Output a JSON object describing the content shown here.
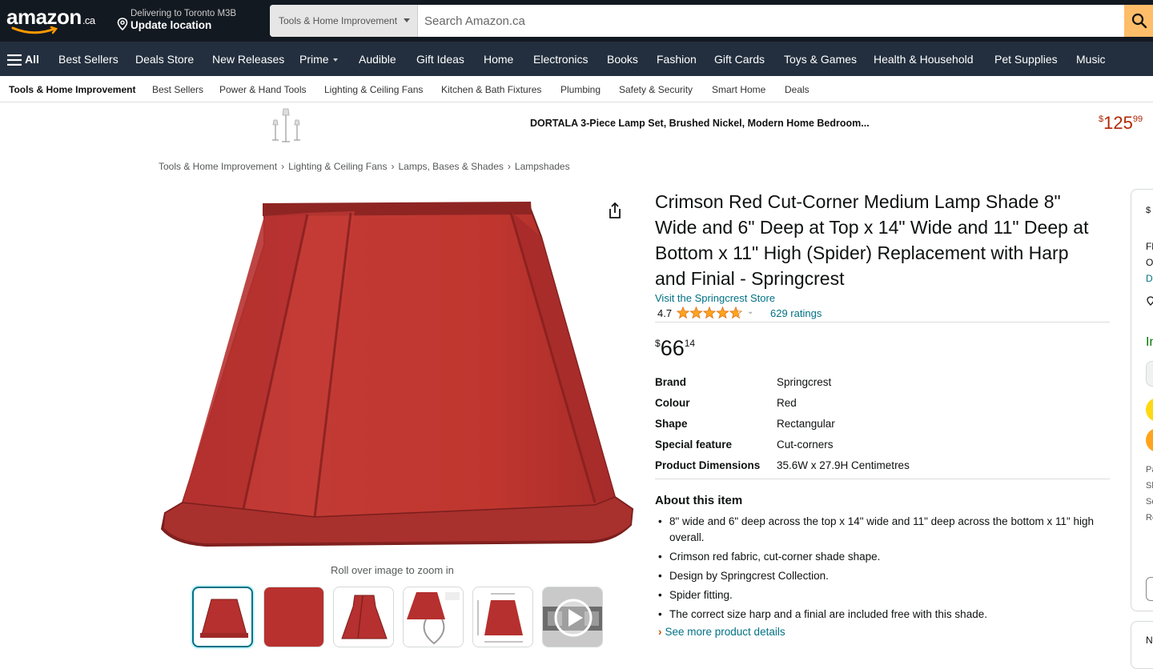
{
  "header": {
    "logo_text": "amazon",
    "logo_suffix": ".ca",
    "deliver_line1": "Delivering to Toronto M3B",
    "deliver_line2": "Update location",
    "search_category": "Tools & Home Improvement",
    "search_placeholder": "Search Amazon.ca"
  },
  "nav": {
    "all_label": "All",
    "items": [
      "Best Sellers",
      "Deals Store",
      "New Releases",
      "Prime",
      "Audible",
      "Gift Ideas",
      "Home",
      "Electronics",
      "Books",
      "Fashion",
      "Gift Cards",
      "Toys & Games",
      "Health & Household",
      "Pet Supplies",
      "Music"
    ]
  },
  "subnav": {
    "items": [
      "Tools & Home Improvement",
      "Best Sellers",
      "Power & Hand Tools",
      "Lighting & Ceiling Fans",
      "Kitchen & Bath Fixtures",
      "Plumbing",
      "Safety & Security",
      "Smart Home",
      "Deals"
    ]
  },
  "promo": {
    "title": "DORTALA 3-Piece Lamp Set, Brushed Nickel, Modern Home Bedroom...",
    "price_symbol": "$",
    "price_whole": "125",
    "price_fraction": "99"
  },
  "breadcrumb": [
    "Tools & Home Improvement",
    "Lighting & Ceiling Fans",
    "Lamps, Bases & Shades",
    "Lampshades"
  ],
  "breadcrumb_sep": "›",
  "gallery": {
    "zoom_hint": "Roll over image to zoom in"
  },
  "product": {
    "title": "Crimson Red Cut-Corner Medium Lamp Shade 8\" Wide and 6\" Deep at Top x 14\" Wide and 11\" Deep at Bottom x 11\" High (Spider) Replacement with Harp and Finial - Springcrest",
    "store_link": "Visit the Springcrest Store",
    "rating": "4.7",
    "rating_value": 4.7,
    "ratings_count": "629 ratings",
    "price_symbol": "$",
    "price_whole": "66",
    "price_fraction": "14",
    "specs": [
      {
        "label": "Brand",
        "value": "Springcrest"
      },
      {
        "label": "Colour",
        "value": "Red"
      },
      {
        "label": "Shape",
        "value": "Rectangular"
      },
      {
        "label": "Special feature",
        "value": "Cut-corners"
      },
      {
        "label": "Product Dimensions",
        "value": "35.6W x 27.9H Centimetres"
      }
    ],
    "about_heading": "About this item",
    "bullets": [
      "8\" wide and 6\" deep across the top x 14\" wide and 11\" deep across the bottom x 11\" high overall.",
      "Crimson red fabric, cut-corner shade shape.",
      "Design by Springcrest Collection.",
      "Spider fitting.",
      "The correct size harp and a finial are included free with this shade."
    ],
    "see_more": "See more product details"
  },
  "buybox_fragments": [
    "$",
    "Fl",
    "O",
    "D",
    "In",
    "Pa",
    "Sh",
    "Sc",
    "Re",
    "N"
  ],
  "colors": {
    "header_bg": "#131921",
    "nav_bg": "#232f3e",
    "search_button": "#febd69",
    "link": "#007185",
    "price_red": "#b12704",
    "shade_red": "#b8312f",
    "star": "#ffa41c",
    "in_stock": "#007600"
  }
}
